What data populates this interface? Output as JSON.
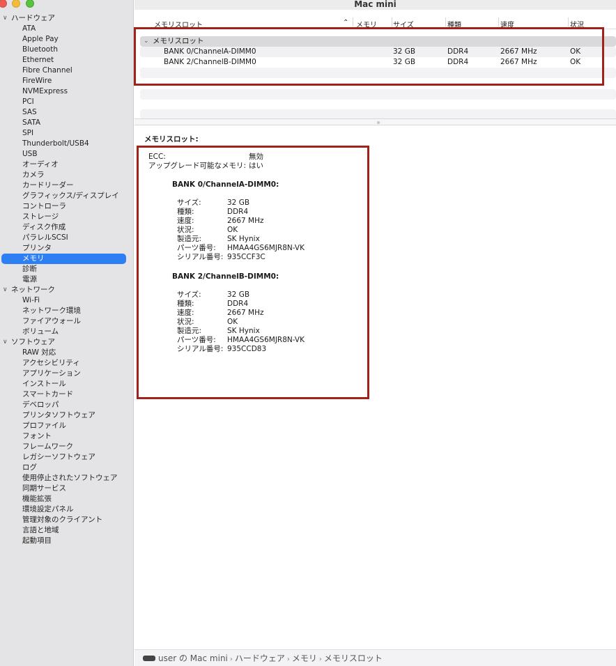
{
  "window": {
    "title": "Mac mini"
  },
  "sidebar": {
    "groups": [
      {
        "label": "ハードウェア",
        "items": [
          "ATA",
          "Apple Pay",
          "Bluetooth",
          "Ethernet",
          "Fibre Channel",
          "FireWire",
          "NVMExpress",
          "PCI",
          "SAS",
          "SATA",
          "SPI",
          "Thunderbolt/USB4",
          "USB",
          "オーディオ",
          "カメラ",
          "カードリーダー",
          "グラフィックス/ディスプレイ",
          "コントローラ",
          "ストレージ",
          "ディスク作成",
          "パラレルSCSI",
          "プリンタ",
          "メモリ",
          "診断",
          "電源"
        ]
      },
      {
        "label": "ネットワーク",
        "items": [
          "Wi-Fi",
          "ネットワーク環境",
          "ファイアウォール",
          "ボリューム"
        ]
      },
      {
        "label": "ソフトウェア",
        "items": [
          "RAW 対応",
          "アクセシビリティ",
          "アプリケーション",
          "インストール",
          "スマートカード",
          "デベロッパ",
          "プリンタソフトウェア",
          "プロファイル",
          "フォント",
          "フレームワーク",
          "レガシーソフトウェア",
          "ログ",
          "使用停止されたソフトウェア",
          "同期サービス",
          "機能拡張",
          "環境設定パネル",
          "管理対象のクライアント",
          "言語と地域",
          "起動項目"
        ]
      }
    ],
    "selected": "メモリ"
  },
  "table": {
    "columns": [
      "メモリスロット",
      "メモリ",
      "サイズ",
      "種類",
      "速度",
      "状況"
    ],
    "group_label": "メモリスロット",
    "rows": [
      {
        "name": "BANK 0/ChannelA-DIMM0",
        "size": "32 GB",
        "type": "DDR4",
        "speed": "2667 MHz",
        "status": "OK"
      },
      {
        "name": "BANK 2/ChannelB-DIMM0",
        "size": "32 GB",
        "type": "DDR4",
        "speed": "2667 MHz",
        "status": "OK"
      }
    ]
  },
  "detail": {
    "title": "メモリスロット:",
    "ecc_label": "ECC:",
    "ecc_value": "無効",
    "upgrade_label": "アップグレード可能なメモリ:",
    "upgrade_value": "はい",
    "banks": [
      {
        "title": "BANK 0/ChannelA-DIMM0:",
        "fields": [
          [
            "サイズ:",
            "32 GB"
          ],
          [
            "種類:",
            "DDR4"
          ],
          [
            "速度:",
            "2667 MHz"
          ],
          [
            "状況:",
            "OK"
          ],
          [
            "製造元:",
            "SK Hynix"
          ],
          [
            "パーツ番号:",
            "HMAA4GS6MJR8N-VK"
          ],
          [
            "シリアル番号:",
            "935CCF3C"
          ]
        ]
      },
      {
        "title": "BANK 2/ChannelB-DIMM0:",
        "fields": [
          [
            "サイズ:",
            "32 GB"
          ],
          [
            "種類:",
            "DDR4"
          ],
          [
            "速度:",
            "2667 MHz"
          ],
          [
            "状況:",
            "OK"
          ],
          [
            "製造元:",
            "SK Hynix"
          ],
          [
            "パーツ番号:",
            "HMAA4GS6MJR8N-VK"
          ],
          [
            "シリアル番号:",
            "935CCD83"
          ]
        ]
      }
    ]
  },
  "statusbar": {
    "icon": "mac-mini-icon",
    "crumbs": [
      "user の Mac mini",
      "ハードウェア",
      "メモリ",
      "メモリスロット"
    ]
  },
  "colors": {
    "selection": "#2f7ff4",
    "highlight_box": "#a02218"
  }
}
